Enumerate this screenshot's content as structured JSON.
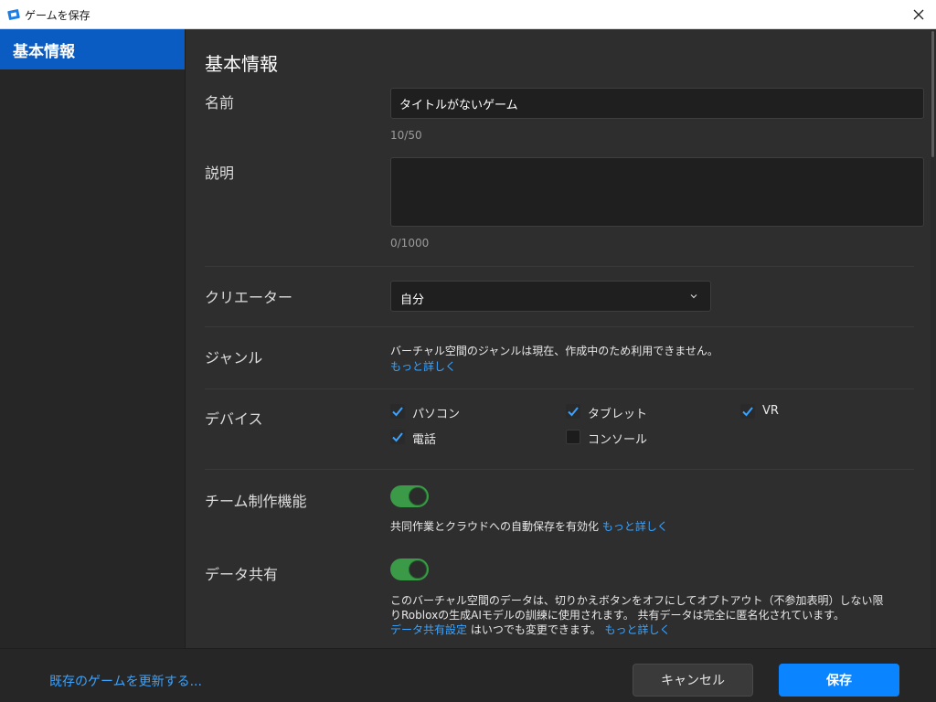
{
  "window": {
    "title": "ゲームを保存"
  },
  "sidebar": {
    "items": [
      {
        "label": "基本情報"
      }
    ]
  },
  "section": {
    "title": "基本情報"
  },
  "name": {
    "label": "名前",
    "value": "タイトルがないゲーム",
    "counter": "10/50"
  },
  "description": {
    "label": "説明",
    "value": "",
    "counter": "0/1000"
  },
  "creator": {
    "label": "クリエーター",
    "selected": "自分"
  },
  "genre": {
    "label": "ジャンル",
    "text": "バーチャル空間のジャンルは現在、作成中のため利用できません。",
    "link": "もっと詳しく"
  },
  "devices": {
    "label": "デバイス",
    "items": [
      {
        "label": "パソコン",
        "checked": true
      },
      {
        "label": "タブレット",
        "checked": true
      },
      {
        "label": "VR",
        "checked": true
      },
      {
        "label": "電話",
        "checked": true
      },
      {
        "label": "コンソール",
        "checked": false
      }
    ]
  },
  "team_create": {
    "label": "チーム制作機能",
    "enabled": true,
    "text": "共同作業とクラウドへの自動保存を有効化",
    "link": "もっと詳しく"
  },
  "data_sharing": {
    "label": "データ共有",
    "enabled": true,
    "line1": "このバーチャル空間のデータは、切りかえボタンをオフにしてオプトアウト（不参加表明）しない限",
    "line2": "りRobloxの生成AIモデルの訓練に使用されます。 共有データは完全に匿名化されています。",
    "settings_link": "データ共有設定",
    "line3": " はいつでも変更できます。",
    "link": "もっと詳しく"
  },
  "footer": {
    "update_link": "既存のゲームを更新する...",
    "cancel": "キャンセル",
    "save": "保存"
  },
  "colors": {
    "accent": "#0b84ff",
    "sidebar_selected": "#0b5cc2",
    "link": "#3aa3ff",
    "toggle_on": "#3b9a48",
    "check": "#3aa3ff"
  }
}
